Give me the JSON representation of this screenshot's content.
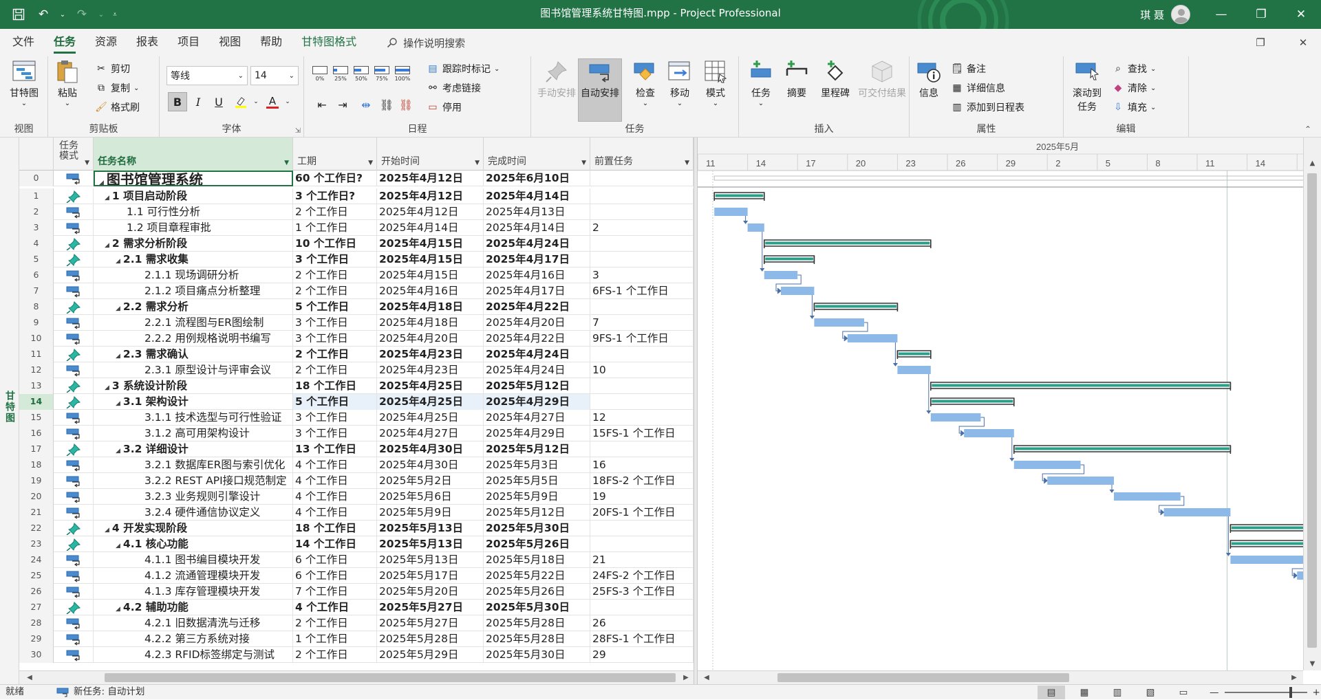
{
  "window": {
    "title": "图书馆管理系统甘特图.mpp  -  Project Professional",
    "user": "琪 聂"
  },
  "menu": {
    "tabs": [
      "文件",
      "任务",
      "资源",
      "报表",
      "项目",
      "视图",
      "帮助",
      "甘特图格式"
    ],
    "active": "任务",
    "search": "操作说明搜索"
  },
  "ribbon": {
    "view": {
      "gantt": "甘特图",
      "group": "视图"
    },
    "clipboard": {
      "paste": "粘贴",
      "cut": "剪切",
      "copy": "复制",
      "format_painter": "格式刷",
      "group": "剪贴板"
    },
    "font": {
      "family": "等线",
      "size": "14",
      "bold": "B",
      "italic": "I",
      "underline": "U",
      "color_letter": "A",
      "group": "字体"
    },
    "schedule": {
      "pcts": [
        "0%",
        "25%",
        "50%",
        "75%",
        "100%"
      ],
      "track": "跟踪时标记",
      "respect_links": "考虑链接",
      "deactivate": "停用",
      "group": "日程"
    },
    "tasks": {
      "manual": "手动安排",
      "auto": "自动安排",
      "inspect": "检查",
      "move": "移动",
      "mode": "模式",
      "group": "任务"
    },
    "insert": {
      "task": "任务",
      "summary": "摘要",
      "milestone": "里程碑",
      "deliverable": "可交付结果",
      "group": "插入"
    },
    "properties": {
      "info": "信息",
      "notes": "备注",
      "details": "详细信息",
      "add_timeline": "添加到日程表",
      "group": "属性"
    },
    "editing": {
      "scroll_to": "滚动到",
      "scroll_to2": "任务",
      "find": "查找",
      "clear": "清除",
      "fill": "填充",
      "group": "编辑"
    }
  },
  "view_label": "甘特图",
  "table": {
    "headers": {
      "mode_line1": "任务",
      "mode_line2": "模式",
      "name": "任务名称",
      "duration": "工期",
      "start": "开始时间",
      "finish": "完成时间",
      "predecessors": "前置任务"
    },
    "rows": [
      {
        "id": "0",
        "name": "图书馆管理系统",
        "dur": "60 个工作日?",
        "start": "2025年4月12日",
        "finish": "2025年6月10日",
        "pred": "",
        "level": 0,
        "summary": true,
        "project": true,
        "mode": "auto"
      },
      {
        "id": "1",
        "name": "1 项目启动阶段",
        "dur": "3 个工作日?",
        "start": "2025年4月12日",
        "finish": "2025年4月14日",
        "pred": "",
        "level": 1,
        "summary": true,
        "mode": "manual"
      },
      {
        "id": "2",
        "name": "1.1 可行性分析",
        "dur": "2 个工作日",
        "start": "2025年4月12日",
        "finish": "2025年4月13日",
        "pred": "",
        "level": 2,
        "summary": false,
        "mode": "auto"
      },
      {
        "id": "3",
        "name": "1.2 项目章程审批",
        "dur": "1 个工作日",
        "start": "2025年4月14日",
        "finish": "2025年4月14日",
        "pred": "2",
        "level": 2,
        "summary": false,
        "mode": "auto"
      },
      {
        "id": "4",
        "name": "2 需求分析阶段",
        "dur": "10 个工作日",
        "start": "2025年4月15日",
        "finish": "2025年4月24日",
        "pred": "",
        "level": 1,
        "summary": true,
        "mode": "manual"
      },
      {
        "id": "5",
        "name": "2.1 需求收集",
        "dur": "3 个工作日",
        "start": "2025年4月15日",
        "finish": "2025年4月17日",
        "pred": "",
        "level": 2,
        "summary": true,
        "mode": "manual"
      },
      {
        "id": "6",
        "name": "2.1.1 现场调研分析",
        "dur": "2 个工作日",
        "start": "2025年4月15日",
        "finish": "2025年4月16日",
        "pred": "3",
        "level": 3,
        "summary": false,
        "mode": "auto"
      },
      {
        "id": "7",
        "name": "2.1.2 项目痛点分析整理",
        "dur": "2 个工作日",
        "start": "2025年4月16日",
        "finish": "2025年4月17日",
        "pred": "6FS-1 个工作日",
        "level": 3,
        "summary": false,
        "mode": "auto"
      },
      {
        "id": "8",
        "name": "2.2 需求分析",
        "dur": "5 个工作日",
        "start": "2025年4月18日",
        "finish": "2025年4月22日",
        "pred": "",
        "level": 2,
        "summary": true,
        "mode": "manual"
      },
      {
        "id": "9",
        "name": "2.2.1 流程图与ER图绘制",
        "dur": "3 个工作日",
        "start": "2025年4月18日",
        "finish": "2025年4月20日",
        "pred": "7",
        "level": 3,
        "summary": false,
        "mode": "auto"
      },
      {
        "id": "10",
        "name": "2.2.2 用例规格说明书编写",
        "dur": "3 个工作日",
        "start": "2025年4月20日",
        "finish": "2025年4月22日",
        "pred": "9FS-1 个工作日",
        "level": 3,
        "summary": false,
        "mode": "auto"
      },
      {
        "id": "11",
        "name": "2.3 需求确认",
        "dur": "2 个工作日",
        "start": "2025年4月23日",
        "finish": "2025年4月24日",
        "pred": "",
        "level": 2,
        "summary": true,
        "mode": "manual"
      },
      {
        "id": "12",
        "name": "2.3.1 原型设计与评审会议",
        "dur": "2 个工作日",
        "start": "2025年4月23日",
        "finish": "2025年4月24日",
        "pred": "10",
        "level": 3,
        "summary": false,
        "mode": "auto"
      },
      {
        "id": "13",
        "name": "3 系统设计阶段",
        "dur": "18 个工作日",
        "start": "2025年4月25日",
        "finish": "2025年5月12日",
        "pred": "",
        "level": 1,
        "summary": true,
        "mode": "manual"
      },
      {
        "id": "14",
        "name": "3.1 架构设计",
        "dur": "5 个工作日",
        "start": "2025年4月25日",
        "finish": "2025年4月29日",
        "pred": "",
        "level": 2,
        "summary": true,
        "mode": "manual",
        "selected": true
      },
      {
        "id": "15",
        "name": "3.1.1 技术选型与可行性验证",
        "dur": "3 个工作日",
        "start": "2025年4月25日",
        "finish": "2025年4月27日",
        "pred": "12",
        "level": 3,
        "summary": false,
        "mode": "auto"
      },
      {
        "id": "16",
        "name": "3.1.2 高可用架构设计",
        "dur": "3 个工作日",
        "start": "2025年4月27日",
        "finish": "2025年4月29日",
        "pred": "15FS-1 个工作日",
        "level": 3,
        "summary": false,
        "mode": "auto"
      },
      {
        "id": "17",
        "name": "3.2  详细设计",
        "dur": "13 个工作日",
        "start": "2025年4月30日",
        "finish": "2025年5月12日",
        "pred": "",
        "level": 2,
        "summary": true,
        "mode": "manual"
      },
      {
        "id": "18",
        "name": "3.2.1 数据库ER图与索引优化",
        "dur": "4 个工作日",
        "start": "2025年4月30日",
        "finish": "2025年5月3日",
        "pred": "16",
        "level": 3,
        "summary": false,
        "mode": "auto"
      },
      {
        "id": "19",
        "name": "3.2.2 REST API接口规范制定",
        "dur": "4 个工作日",
        "start": "2025年5月2日",
        "finish": "2025年5月5日",
        "pred": "18FS-2 个工作日",
        "level": 3,
        "summary": false,
        "mode": "auto"
      },
      {
        "id": "20",
        "name": "3.2.3 业务规则引擎设计",
        "dur": "4 个工作日",
        "start": "2025年5月6日",
        "finish": "2025年5月9日",
        "pred": "19",
        "level": 3,
        "summary": false,
        "mode": "auto"
      },
      {
        "id": "21",
        "name": "3.2.4 硬件通信协议定义",
        "dur": "4 个工作日",
        "start": "2025年5月9日",
        "finish": "2025年5月12日",
        "pred": "20FS-1 个工作日",
        "level": 3,
        "summary": false,
        "mode": "auto"
      },
      {
        "id": "22",
        "name": "4 开发实现阶段",
        "dur": "18 个工作日",
        "start": "2025年5月13日",
        "finish": "2025年5月30日",
        "pred": "",
        "level": 1,
        "summary": true,
        "mode": "manual"
      },
      {
        "id": "23",
        "name": "4.1 核心功能",
        "dur": "14 个工作日",
        "start": "2025年5月13日",
        "finish": "2025年5月26日",
        "pred": "",
        "level": 2,
        "summary": true,
        "mode": "manual"
      },
      {
        "id": "24",
        "name": "4.1.1 图书编目模块开发",
        "dur": "6 个工作日",
        "start": "2025年5月13日",
        "finish": "2025年5月18日",
        "pred": "21",
        "level": 3,
        "summary": false,
        "mode": "auto"
      },
      {
        "id": "25",
        "name": "4.1.2 流通管理模块开发",
        "dur": "6 个工作日",
        "start": "2025年5月17日",
        "finish": "2025年5月22日",
        "pred": "24FS-2 个工作日",
        "level": 3,
        "summary": false,
        "mode": "auto"
      },
      {
        "id": "26",
        "name": "4.1.3 库存管理模块开发",
        "dur": "7 个工作日",
        "start": "2025年5月20日",
        "finish": "2025年5月26日",
        "pred": "25FS-3 个工作日",
        "level": 3,
        "summary": false,
        "mode": "auto"
      },
      {
        "id": "27",
        "name": "4.2 辅助功能",
        "dur": "4 个工作日",
        "start": "2025年5月27日",
        "finish": "2025年5月30日",
        "pred": "",
        "level": 2,
        "summary": true,
        "mode": "manual"
      },
      {
        "id": "28",
        "name": "4.2.1 旧数据清洗与迁移",
        "dur": "2 个工作日",
        "start": "2025年5月27日",
        "finish": "2025年5月28日",
        "pred": "26",
        "level": 3,
        "summary": false,
        "mode": "auto"
      },
      {
        "id": "29",
        "name": "4.2.2 第三方系统对接",
        "dur": "1 个工作日",
        "start": "2025年5月28日",
        "finish": "2025年5月28日",
        "pred": "28FS-1 个工作日",
        "level": 3,
        "summary": false,
        "mode": "auto"
      },
      {
        "id": "30",
        "name": "4.2.3 RFID标签绑定与测试",
        "dur": "2 个工作日",
        "start": "2025年5月29日",
        "finish": "2025年5月30日",
        "pred": "29",
        "level": 3,
        "summary": false,
        "mode": "auto"
      }
    ]
  },
  "gantt": {
    "month_label": "2025年5月",
    "day_ticks": [
      "11",
      "14",
      "17",
      "20",
      "23",
      "26",
      "29",
      "2",
      "5",
      "8",
      "11",
      "14",
      "1"
    ],
    "timescale_start": "2025-04-11",
    "colors": {
      "task": "#8db9e8",
      "summary": "#29a08a",
      "summary_border": "#333333",
      "link": "#4a6fa5"
    }
  },
  "status": {
    "ready": "就绪",
    "new_tasks": "新任务: 自动计划"
  }
}
